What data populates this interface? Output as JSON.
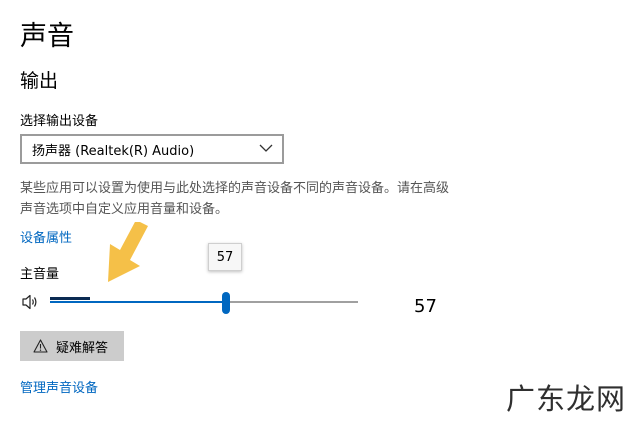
{
  "page": {
    "title": "声音",
    "section": "输出",
    "device_label": "选择输出设备",
    "device_selected": "扬声器 (Realtek(R) Audio)",
    "description": "某些应用可以设置为使用与此处选择的声音设备不同的声音设备。请在高级声音选项中自定义应用音量和设备。",
    "device_properties_link": "设备属性",
    "master_volume_label": "主音量",
    "volume_value": "57",
    "volume_fraction": 0.57,
    "tooltip_value": "57",
    "troubleshoot_button": "疑难解答",
    "manage_devices_link": "管理声音设备"
  },
  "watermark": "广东龙网",
  "icons": {
    "speaker": "speaker-icon",
    "dropdown": "chevron-down-icon",
    "warning": "warning-icon",
    "annotation": "yellow-arrow-icon"
  },
  "colors": {
    "accent": "#0067c0",
    "meter": "#0a2a52",
    "button_bg": "#cccccc",
    "arrow": "#f5c048"
  }
}
